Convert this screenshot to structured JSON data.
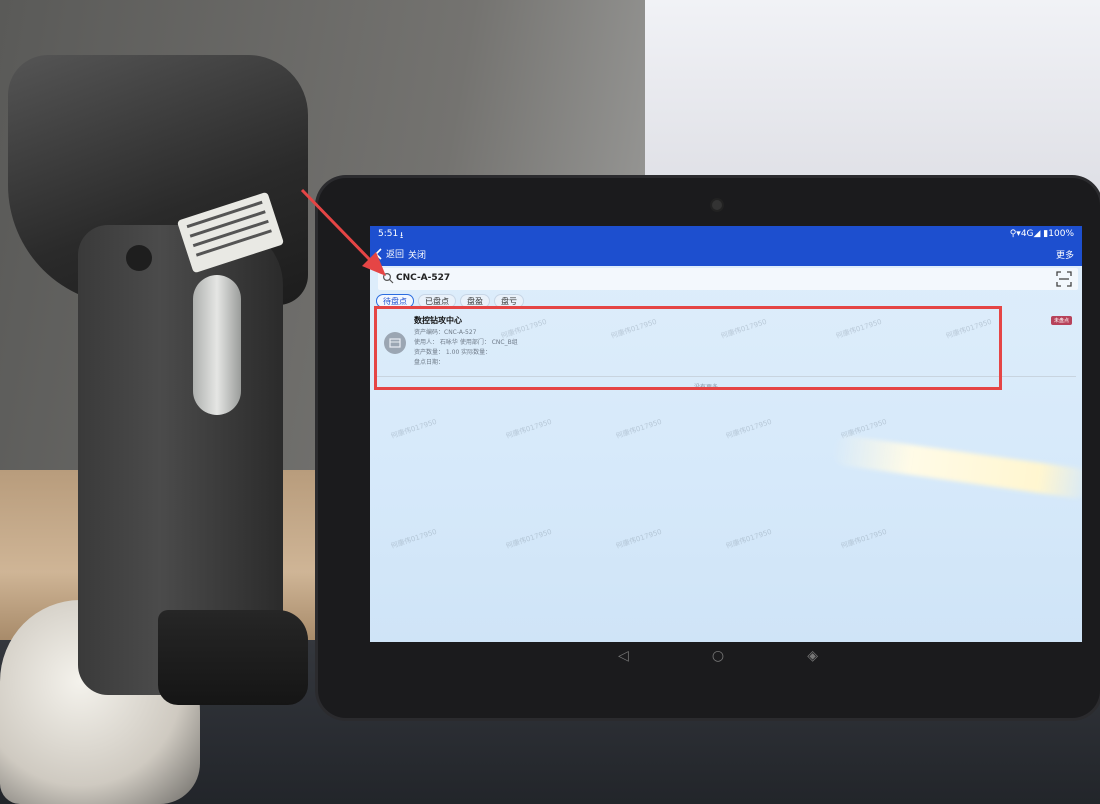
{
  "status_bar": {
    "time": "5:51",
    "download_glyph": "⭳",
    "right": "⚲▾4G◢ ▮100%"
  },
  "app_bar": {
    "back": "返回",
    "close": "关闭",
    "more": "更多"
  },
  "search": {
    "value": "CNC-A-527"
  },
  "tabs": [
    {
      "label": "待盘点",
      "active": true
    },
    {
      "label": "已盘点",
      "active": false
    },
    {
      "label": "盘盈",
      "active": false
    },
    {
      "label": "盘亏",
      "active": false
    }
  ],
  "record": {
    "title": "数控钻攻中心",
    "asset_code": "资产编码：CNC-A-527",
    "user_line": "使用人：  石咏华   使用部门：  CNC_B组",
    "qty_line": "资产数量：  1.00   实际数量：",
    "date_line": "盘点日期：",
    "badge": "未盘点"
  },
  "list_end": "—没有更多—",
  "watermark": "何康伟017950",
  "nav": {
    "back_icon": "◁",
    "home_icon": "○",
    "recents_icon": "◈"
  },
  "colors": {
    "app_bar": "#1d4fcf",
    "highlight": "#e54545",
    "badge": "#b7425a"
  }
}
